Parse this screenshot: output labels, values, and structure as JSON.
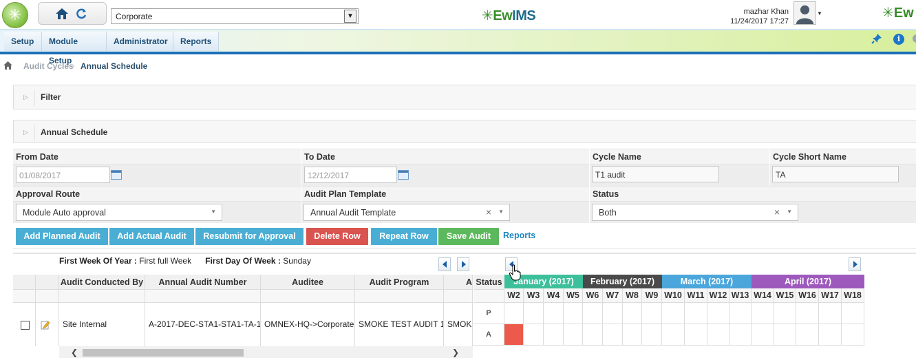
{
  "header": {
    "org_value": "Corporate",
    "center_logo_brand_1": "Ew",
    "center_logo_brand_2": "IMS",
    "right_logo": "Ew",
    "user_name": "mazhar Khan",
    "user_date": "11/24/2017 17:27"
  },
  "nav": {
    "items": [
      {
        "label": "Setup"
      },
      {
        "label": "Module Setup"
      },
      {
        "label": "Administrator"
      },
      {
        "label": "Reports"
      }
    ]
  },
  "breadcrumb": {
    "level1": "Audit Cycles",
    "level2": "Annual Schedule"
  },
  "panels": {
    "filter_title": "Filter",
    "annual_title": "Annual Schedule"
  },
  "form": {
    "from_date_label": "From Date",
    "from_date_value": "01/08/2017",
    "to_date_label": "To Date",
    "to_date_value": "12/12/2017",
    "cycle_name_label": "Cycle Name",
    "cycle_name_value": "T1 audit",
    "cycle_short_label": "Cycle Short Name",
    "cycle_short_value": "TA",
    "approval_label": "Approval Route",
    "approval_value": "Module Auto approval",
    "template_label": "Audit Plan Template",
    "template_value": "Annual Audit Template",
    "status_label": "Status",
    "status_value": "Both"
  },
  "buttons": {
    "add_planned": "Add Planned Audit",
    "add_actual": "Add Actual Audit",
    "resubmit": "Resubmit for Approval",
    "delete_row": "Delete Row",
    "repeat_row": "Repeat Row",
    "save_audit": "Save Audit",
    "reports_link": "Reports"
  },
  "week_info": {
    "first_week_label": "First Week Of Year :",
    "first_week_value": "First full Week",
    "first_day_label": "First Day Of Week :",
    "first_day_value": "Sunday"
  },
  "table": {
    "columns": [
      "Audit Conducted By",
      "Annual Audit Number",
      "Auditee",
      "Audit Program",
      "Audit"
    ],
    "row": {
      "conducted_by": "Site Internal",
      "audit_number": "A-2017-DEC-STA1-STA1-TA-1",
      "auditee": "OMNEX-HQ->Corporate",
      "program": "SMOKE TEST AUDIT 1",
      "extra": "SMOKE"
    }
  },
  "status_col": {
    "header": "Status",
    "rows": [
      "P",
      "A"
    ]
  },
  "calendar": {
    "months": [
      {
        "label": "January (2017)",
        "color": "#3dbf9b"
      },
      {
        "label": "February (2017)",
        "color": "#4a4a4a"
      },
      {
        "label": "March (2017)",
        "color": "#4aa6db"
      },
      {
        "label": "April (2017)",
        "color": "#9e59bd"
      }
    ],
    "weeks": [
      "W2",
      "W3",
      "W4",
      "W5",
      "W6",
      "W7",
      "W8",
      "W9",
      "W10",
      "W11",
      "W12",
      "W13",
      "W14",
      "W15",
      "W16",
      "W17",
      "W18"
    ],
    "actual_marked_week": "W2",
    "actual_color": "#ec5a4c"
  }
}
